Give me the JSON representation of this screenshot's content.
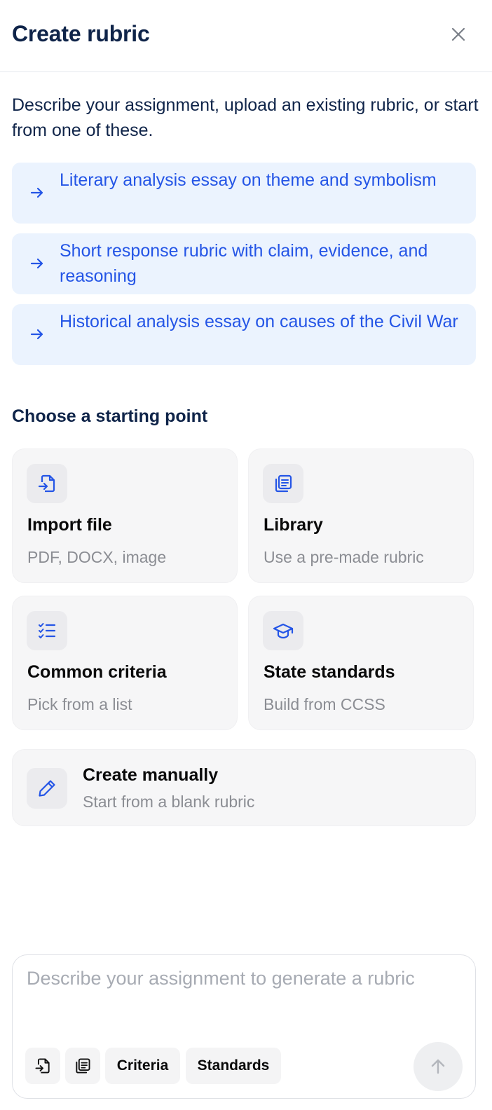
{
  "header": {
    "title": "Create rubric",
    "close_icon": "close-icon"
  },
  "intro": "Describe your assignment, upload an existing rubric, or start from one of these.",
  "suggestions": [
    {
      "label": "Literary analysis essay on theme and symbolism",
      "icon": "arrow-right-icon"
    },
    {
      "label": "Short response rubric with claim, evidence, and reasoning",
      "icon": "arrow-right-icon"
    },
    {
      "label": "Historical analysis essay on causes of the Civil War",
      "icon": "arrow-right-icon"
    }
  ],
  "starting_point": {
    "title": "Choose a starting point",
    "cards": [
      {
        "title": "Import file",
        "subtitle": "PDF, DOCX, image",
        "icon": "file-import-icon"
      },
      {
        "title": "Library",
        "subtitle": "Use a pre-made rubric",
        "icon": "library-icon"
      },
      {
        "title": "Common criteria",
        "subtitle": "Pick from a list",
        "icon": "checklist-icon"
      },
      {
        "title": "State standards",
        "subtitle": "Build from CCSS",
        "icon": "graduation-cap-icon"
      }
    ],
    "manual": {
      "title": "Create manually",
      "subtitle": "Start from a blank rubric",
      "icon": "pencil-icon"
    }
  },
  "composer": {
    "placeholder": "Describe your assignment to generate a rubric",
    "value": "",
    "tools": [
      {
        "icon": "file-import-icon"
      },
      {
        "icon": "library-icon"
      },
      {
        "label": "Criteria"
      },
      {
        "label": "Standards"
      }
    ],
    "send_icon": "arrow-up-icon"
  },
  "colors": {
    "accent": "#2455e6",
    "suggestion_bg": "#ebf3fe",
    "title_text": "#0f2449",
    "card_bg": "#f6f6f7",
    "muted_text": "#8b8d93"
  }
}
